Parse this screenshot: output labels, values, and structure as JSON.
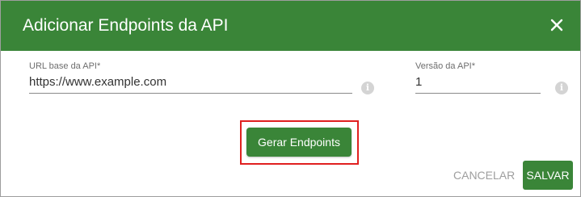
{
  "dialog": {
    "title": "Adicionar Endpoints da API",
    "close_icon": "close-icon"
  },
  "fields": {
    "base_url": {
      "label": "URL base da API*",
      "value": "https://www.example.com",
      "info_icon": "info-icon"
    },
    "api_version": {
      "label": "Versão da API*",
      "value": "1",
      "info_icon": "info-icon"
    }
  },
  "actions": {
    "generate_label": "Gerar Endpoints",
    "cancel_label": "CANCELAR",
    "save_label": "SALVAR"
  },
  "colors": {
    "header_green": "#3a8538",
    "highlight_red": "#e02020",
    "cancel_gray": "#9e9e9e"
  }
}
